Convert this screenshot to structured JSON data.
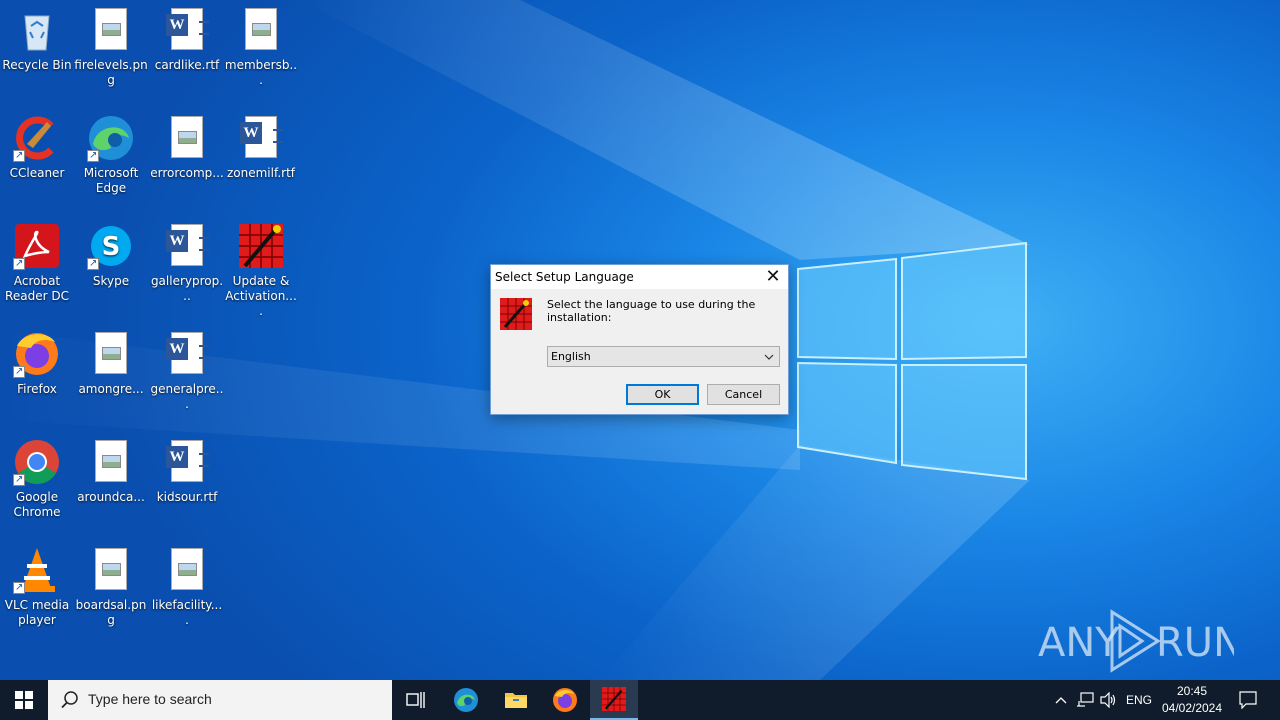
{
  "desktop": {
    "icons": [
      {
        "label": "Recycle Bin",
        "icon": "recycle-bin-icon"
      },
      {
        "label": "firelevels.png",
        "icon": "image-file-icon"
      },
      {
        "label": "cardlike.rtf",
        "icon": "word-document-icon"
      },
      {
        "label": "membersb...",
        "icon": "image-file-icon"
      },
      {
        "label": "CCleaner",
        "icon": "ccleaner-icon"
      },
      {
        "label": "Microsoft Edge",
        "icon": "edge-icon"
      },
      {
        "label": "errorcomp...",
        "icon": "image-file-icon"
      },
      {
        "label": "zonemilf.rtf",
        "icon": "word-document-icon"
      },
      {
        "label": "Acrobat Reader DC",
        "icon": "acrobat-icon"
      },
      {
        "label": "Skype",
        "icon": "skype-icon"
      },
      {
        "label": "galleryprop...",
        "icon": "word-document-icon"
      },
      {
        "label": "Update & Activation....",
        "icon": "setup-app-icon"
      },
      {
        "label": "Firefox",
        "icon": "firefox-icon"
      },
      {
        "label": "amongre...",
        "icon": "image-file-icon"
      },
      {
        "label": "generalpre...",
        "icon": "word-document-icon"
      },
      {
        "label": "Google Chrome",
        "icon": "chrome-icon"
      },
      {
        "label": "aroundca...",
        "icon": "image-file-icon"
      },
      {
        "label": "kidsour.rtf",
        "icon": "word-document-icon"
      },
      {
        "label": "VLC media player",
        "icon": "vlc-icon"
      },
      {
        "label": "boardsal.png",
        "icon": "image-file-icon"
      },
      {
        "label": "likefacility....",
        "icon": "image-file-icon"
      }
    ]
  },
  "dialog": {
    "title": "Select Setup Language",
    "message": "Select the language to use during the installation:",
    "language_selected": "English",
    "ok_label": "OK",
    "cancel_label": "Cancel"
  },
  "watermark": {
    "text": "ANY RUN"
  },
  "taskbar": {
    "search_placeholder": "Type here to search",
    "language": "ENG",
    "time": "20:45",
    "date": "04/02/2024"
  },
  "colors": {
    "taskbar_bg": "#101c2b",
    "accent": "#0078d7",
    "desktop_blue": "#1a86e6"
  }
}
